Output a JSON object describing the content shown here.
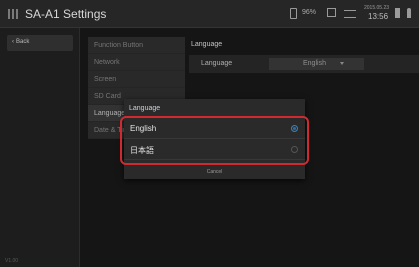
{
  "app": {
    "title": "SA-A1 Settings",
    "version": "V1.00"
  },
  "status_bar": {
    "battery": "96%",
    "date": "2015.05.23",
    "time": "13:56"
  },
  "left_panel": {
    "back_label": "Back"
  },
  "menu": {
    "items": [
      {
        "label": "Function Button"
      },
      {
        "label": "Network"
      },
      {
        "label": "Screen"
      },
      {
        "label": "SD Card"
      },
      {
        "label": "Language"
      },
      {
        "label": "Date & Time"
      }
    ],
    "active_index": 4
  },
  "content": {
    "title": "Language",
    "row_label": "Language",
    "row_value": "English"
  },
  "dialog": {
    "title": "Language",
    "options": [
      {
        "label": "English",
        "selected": true
      },
      {
        "label": "日本語",
        "selected": false
      }
    ],
    "cancel_label": "Cancel"
  },
  "colors": {
    "accent": "#2c6fa6",
    "highlight": "#d02a30",
    "background": "#151515"
  },
  "icons": [
    "app-menu-icon",
    "battery-icon",
    "sd-card-icon",
    "link-icon",
    "card-icon",
    "person-icon",
    "back-chevron-icon",
    "dropdown-arrow-icon"
  ]
}
